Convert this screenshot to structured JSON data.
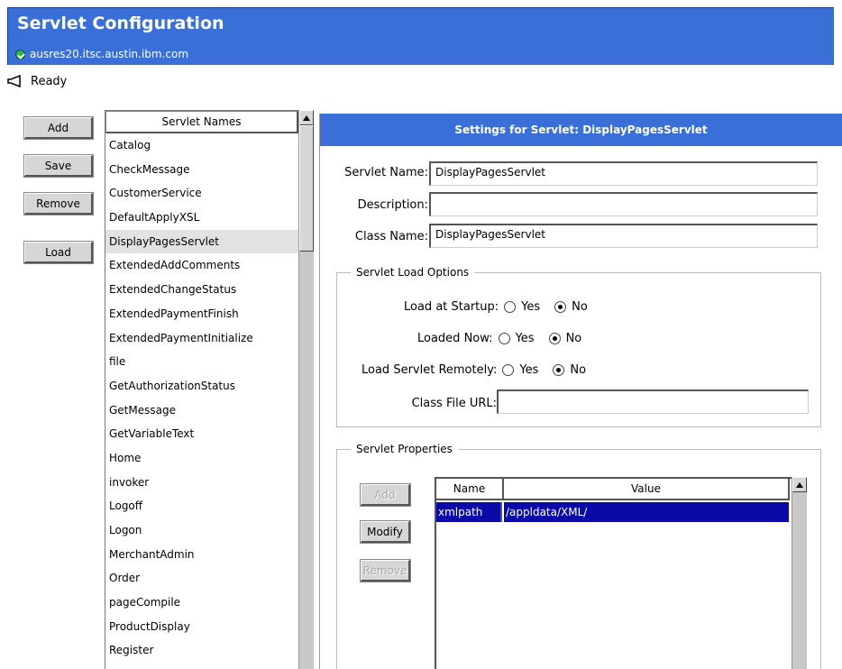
{
  "header": {
    "title": "Servlet Configuration",
    "host": "ausres20.itsc.austin.ibm.com"
  },
  "status": {
    "text": "Ready"
  },
  "left_buttons": {
    "add": "Add",
    "save": "Save",
    "remove": "Remove",
    "load": "Load"
  },
  "servlet_list": {
    "header": "Servlet Names",
    "selected": "DisplayPagesServlet",
    "items": [
      "Catalog",
      "CheckMessage",
      "CustomerService",
      "DefaultApplyXSL",
      "DisplayPagesServlet",
      "ExtendedAddComments",
      "ExtendedChangeStatus",
      "ExtendedPaymentFinish",
      "ExtendedPaymentInitialize",
      "file",
      "GetAuthorizationStatus",
      "GetMessage",
      "GetVariableText",
      "Home",
      "invoker",
      "Logoff",
      "Logon",
      "MerchantAdmin",
      "Order",
      "pageCompile",
      "ProductDisplay",
      "Register"
    ]
  },
  "settings": {
    "title": "Settings for Servlet: DisplayPagesServlet",
    "servlet_name_label": "Servlet Name:",
    "servlet_name_value": "DisplayPagesServlet",
    "description_label": "Description:",
    "description_value": "",
    "class_name_label": "Class Name:",
    "class_name_value": "DisplayPagesServlet"
  },
  "load_options": {
    "legend": "Servlet Load Options",
    "load_at_startup_label": "Load at Startup:",
    "loaded_now_label": "Loaded Now:",
    "load_remotely_label": "Load Servlet Remotely:",
    "yes": "Yes",
    "no": "No",
    "class_file_url_label": "Class File URL:",
    "class_file_url_value": ""
  },
  "properties": {
    "legend": "Servlet Properties",
    "add": "Add",
    "modify": "Modify",
    "remove": "Remove",
    "col_name": "Name",
    "col_value": "Value",
    "rows": [
      {
        "name": "xmlpath",
        "value": "/appldata/XML/"
      }
    ]
  }
}
